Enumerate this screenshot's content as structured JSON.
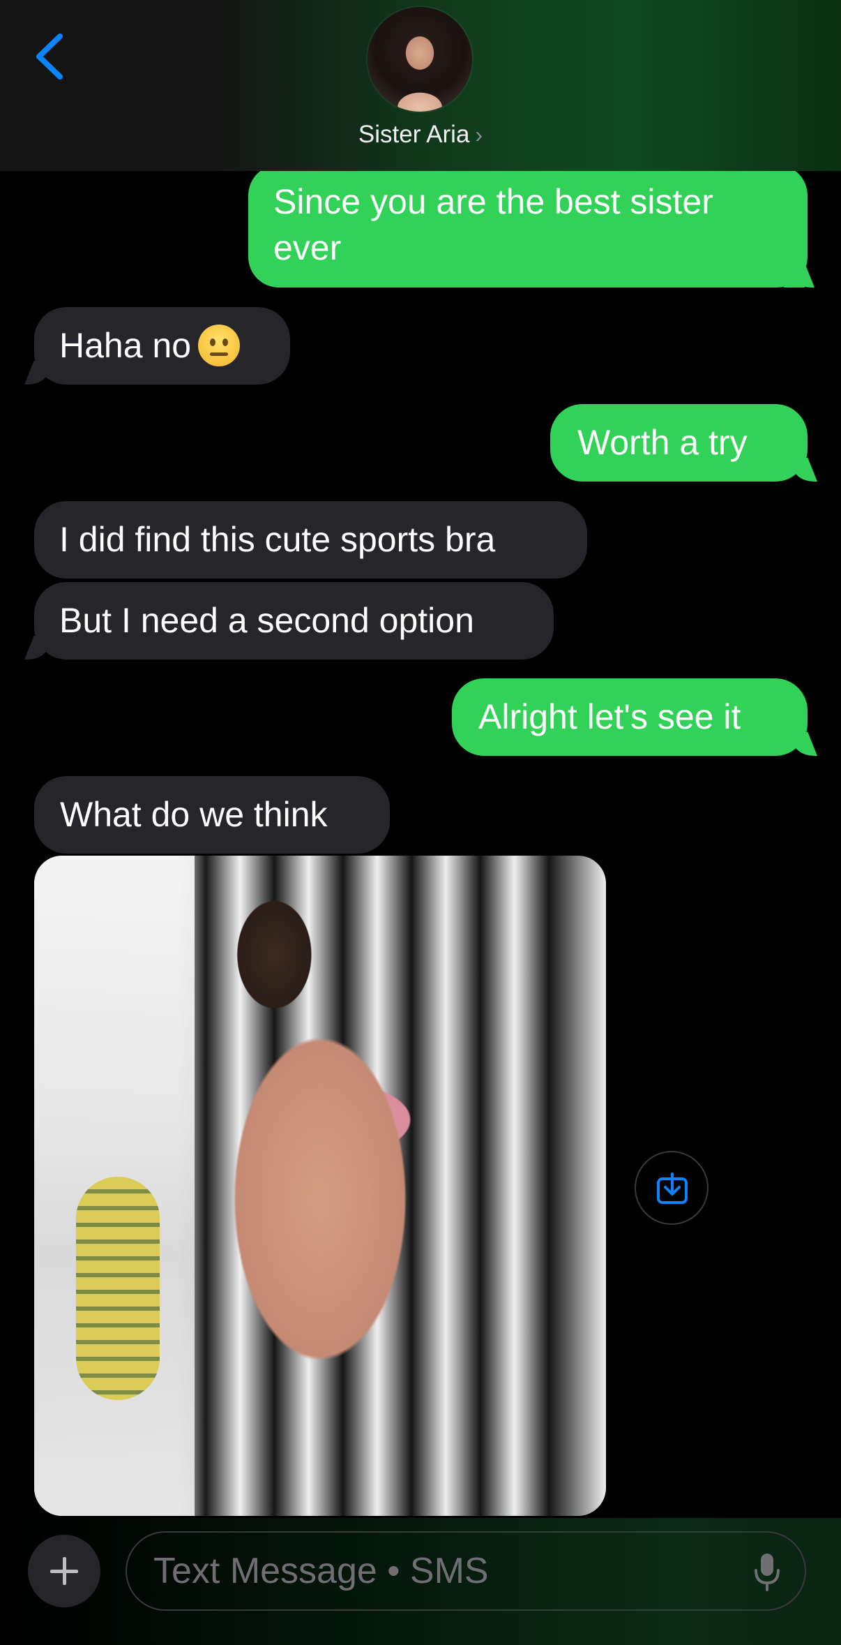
{
  "header": {
    "contact_name": "Sister Aria",
    "chevron": "›",
    "back_icon": "chevron-left-icon"
  },
  "messages": [
    {
      "direction": "outgoing",
      "text": "Since you are the best sister ever"
    },
    {
      "direction": "incoming",
      "text": "Haha no",
      "emoji": "neutral-face-emoji"
    },
    {
      "direction": "outgoing",
      "text": "Worth a try"
    },
    {
      "direction": "incoming",
      "text": "I did find this cute sports bra"
    },
    {
      "direction": "incoming",
      "text": "But I need a second option"
    },
    {
      "direction": "outgoing",
      "text": "Alright let's see it"
    },
    {
      "direction": "incoming",
      "text": "What do we think"
    },
    {
      "direction": "incoming",
      "type": "photo"
    }
  ],
  "composer": {
    "placeholder": "Text Message • SMS",
    "plus_icon": "plus-icon",
    "mic_icon": "microphone-icon"
  },
  "colors": {
    "outgoing_bubble": "#32d158",
    "incoming_bubble": "#26252a",
    "accent": "#0a84ff"
  }
}
